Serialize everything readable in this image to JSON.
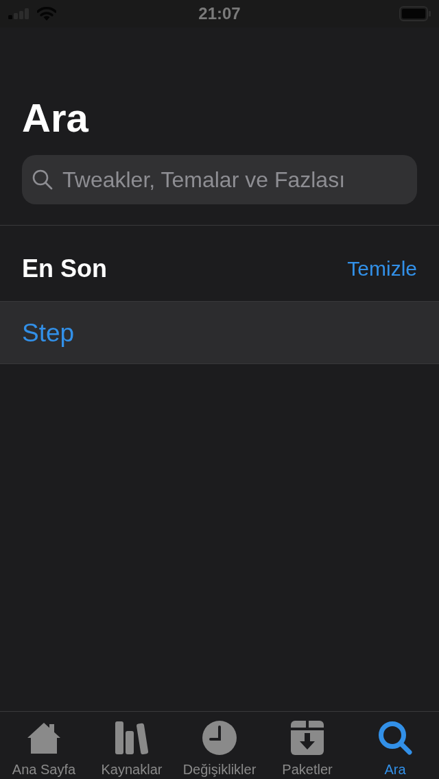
{
  "status_bar": {
    "time": "21:07"
  },
  "title": "Ara",
  "search": {
    "placeholder": "Tweakler, Temalar ve Fazlası"
  },
  "recent": {
    "heading": "En Son",
    "clear_action": "Temizle",
    "items": [
      {
        "label": "Step"
      }
    ]
  },
  "tab_bar": [
    {
      "label": "Ana Sayfa",
      "selected": false
    },
    {
      "label": "Kaynaklar",
      "selected": false
    },
    {
      "label": "Değişiklikler",
      "selected": false
    },
    {
      "label": "Paketler",
      "selected": false
    },
    {
      "label": "Ara",
      "selected": true
    }
  ]
}
